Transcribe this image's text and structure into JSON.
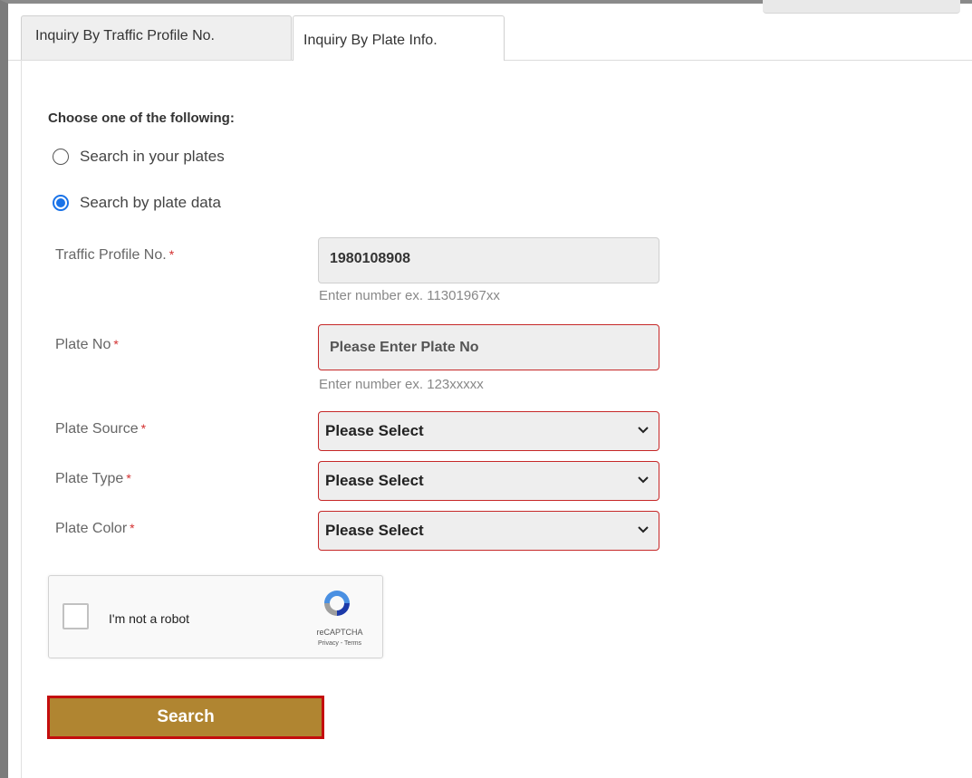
{
  "tabs": [
    {
      "label": "Inquiry By Traffic Profile No.",
      "active": false
    },
    {
      "label": "Inquiry By Plate Info.",
      "active": true
    }
  ],
  "form": {
    "heading": "Choose one of the following:",
    "options": [
      {
        "label": "Search in your plates",
        "selected": false
      },
      {
        "label": "Search by plate data",
        "selected": true
      }
    ],
    "required_mark": "*",
    "traffic_profile": {
      "label": "Traffic Profile No.",
      "value": "1980108908",
      "hint": "Enter number ex. 11301967xx"
    },
    "plate_no": {
      "label": "Plate No",
      "placeholder": "Please Enter Plate No",
      "hint": "Enter number ex. 123xxxxx"
    },
    "plate_source": {
      "label": "Plate Source",
      "selected": "Please Select"
    },
    "plate_type": {
      "label": "Plate Type",
      "selected": "Please Select"
    },
    "plate_color": {
      "label": "Plate Color",
      "selected": "Please Select"
    }
  },
  "captcha": {
    "text": "I'm not a robot",
    "brand": "reCAPTCHA",
    "links": "Privacy - Terms"
  },
  "search_button": {
    "label": "Search"
  },
  "colors": {
    "accent": "#1a73e8",
    "error_border": "#c62828",
    "button_bg": "#b08531",
    "button_border": "#c40d0d"
  }
}
